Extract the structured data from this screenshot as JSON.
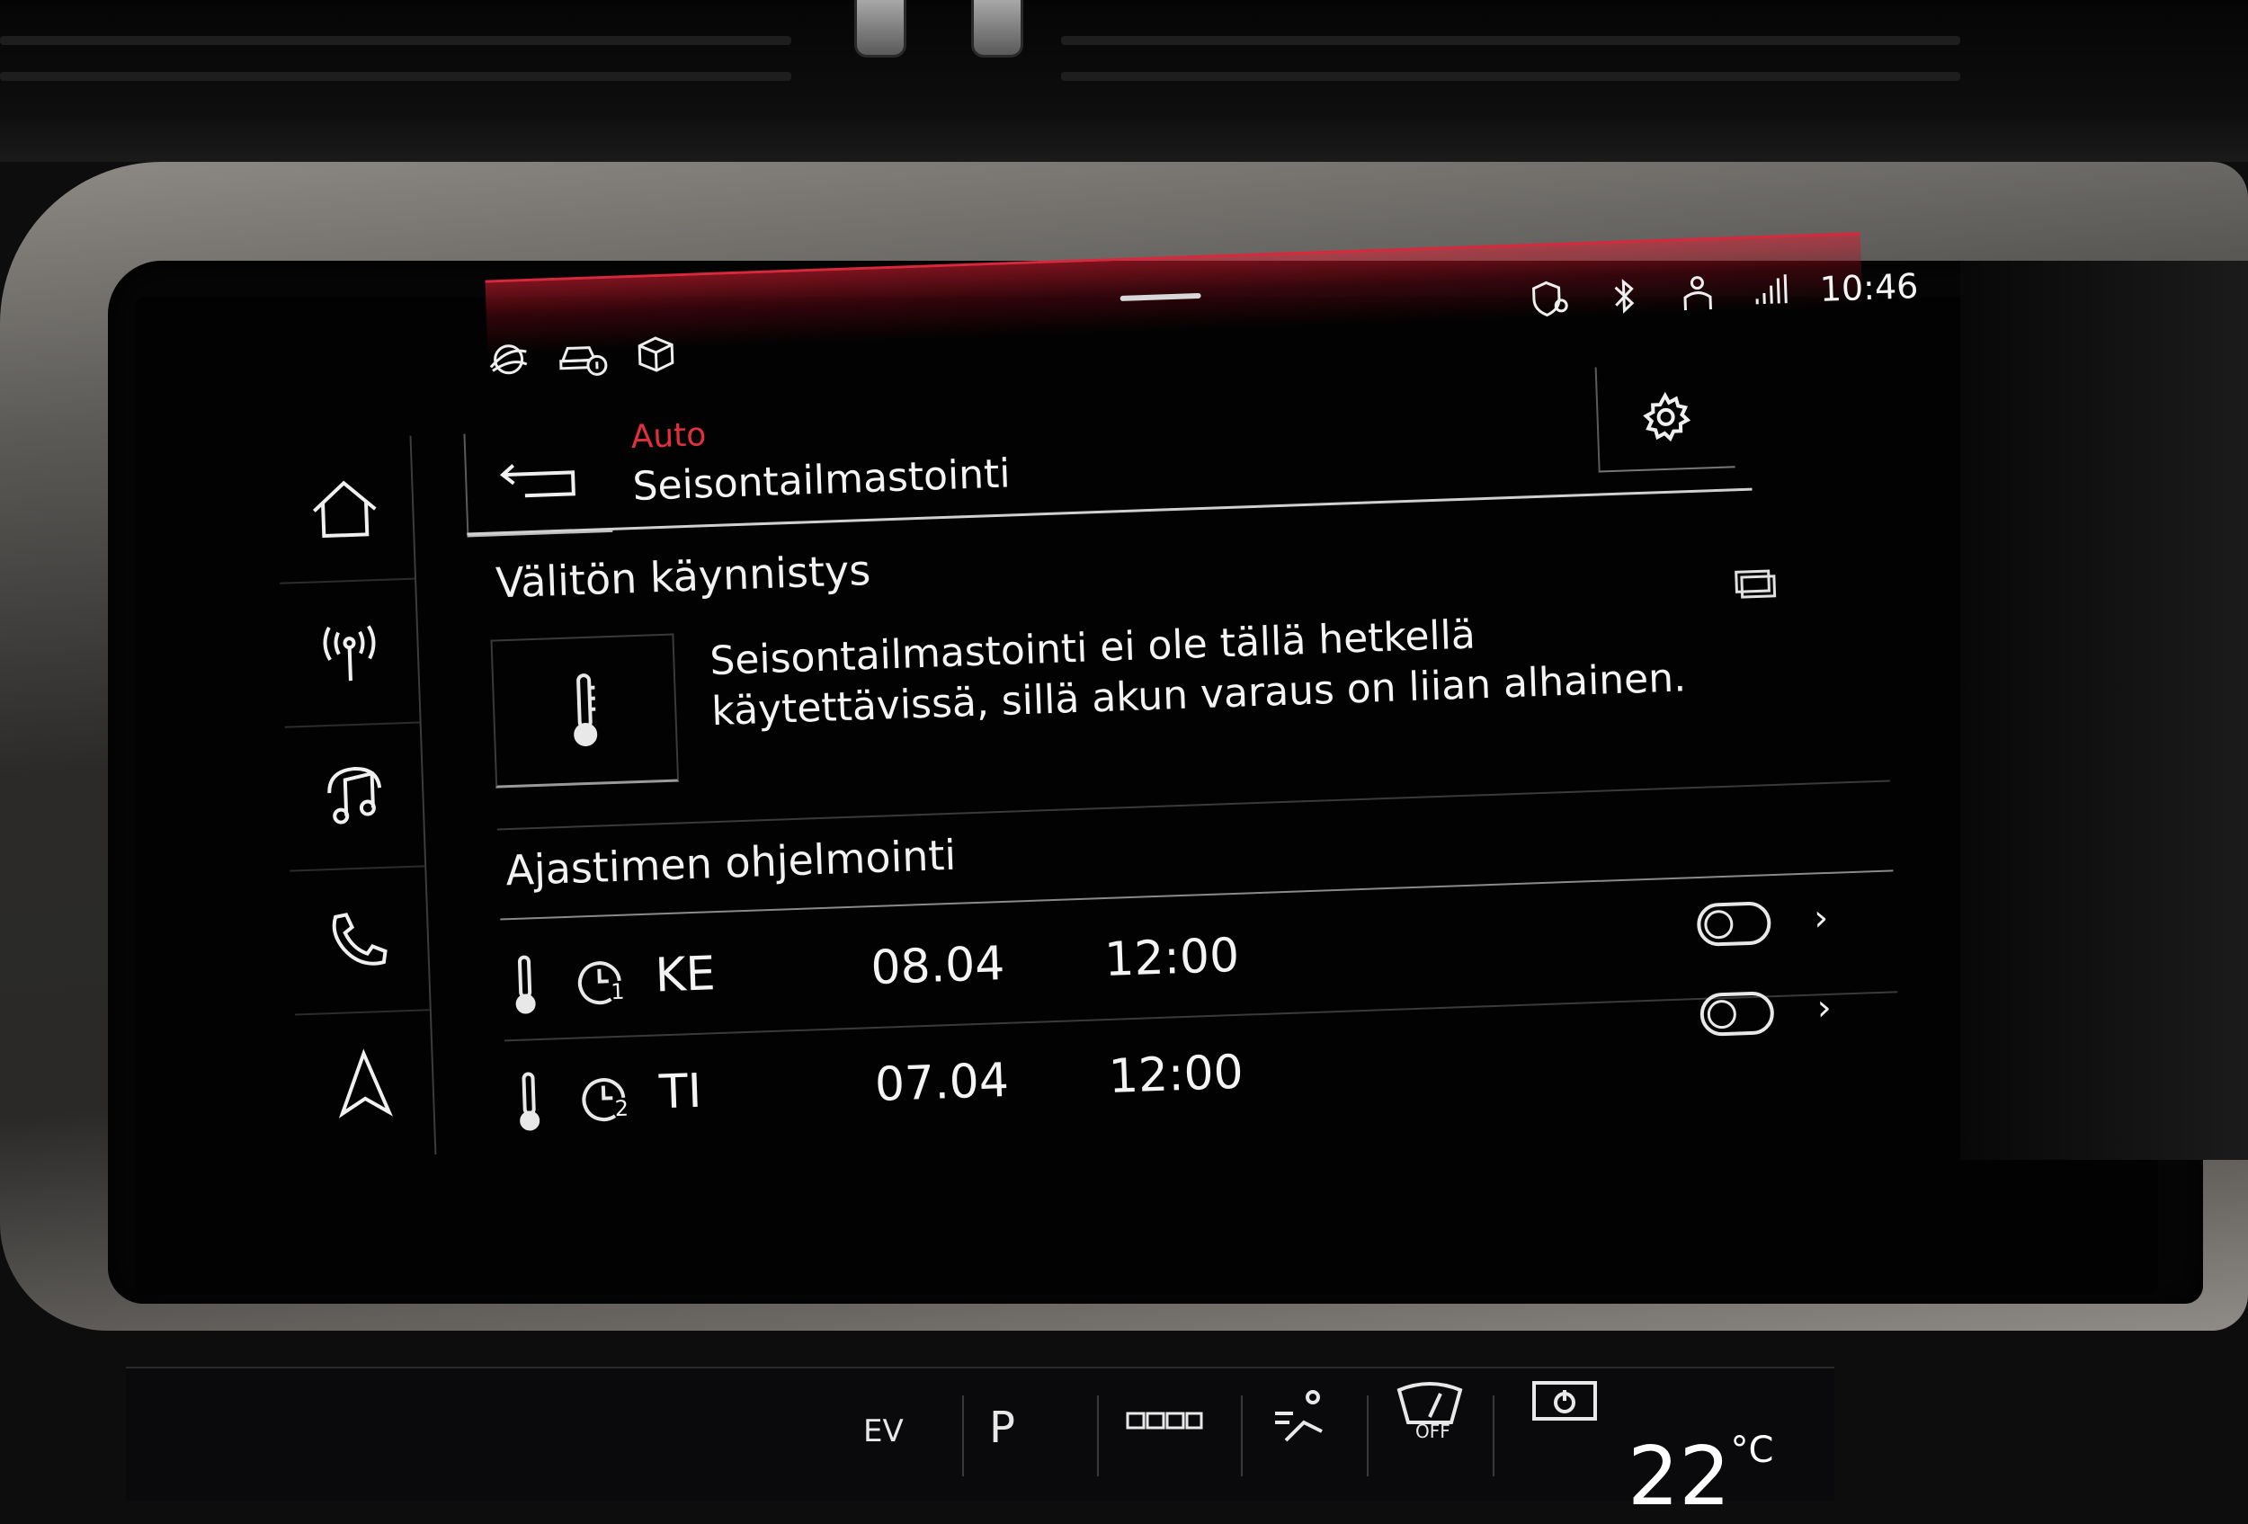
{
  "status_bar": {
    "time": "10:46",
    "left_icons": [
      "connect-services-icon",
      "car-info-icon",
      "package-icon"
    ],
    "right_icons": [
      "location-shield-icon",
      "bluetooth-icon",
      "user-profile-icon",
      "lte-signal-icon"
    ]
  },
  "sidebar": {
    "items": [
      {
        "name": "home",
        "icon": "home-icon"
      },
      {
        "name": "radio",
        "icon": "radio-antenna-icon"
      },
      {
        "name": "media",
        "icon": "music-note-icon"
      },
      {
        "name": "phone",
        "icon": "phone-icon"
      },
      {
        "name": "navigation",
        "icon": "navigation-arrow-icon"
      }
    ]
  },
  "header": {
    "breadcrumb": "Auto",
    "title": "Seisontailmastointi"
  },
  "immediate_start": {
    "title": "Välitön käynnistys",
    "message_line1": "Seisontailmastointi ei ole tällä hetkellä",
    "message_line2": "käytettävissä, sillä akun varaus on liian alhainen."
  },
  "timer_programming": {
    "title": "Ajastimen ohjelmointi",
    "timers": [
      {
        "timer_number": "1",
        "day": "KE",
        "date": "08.04",
        "time": "12:00",
        "enabled": false
      },
      {
        "timer_number": "2",
        "day": "TI",
        "date": "07.04",
        "time": "12:00",
        "enabled": false
      }
    ]
  },
  "climate_bar": {
    "labels": [
      "EV",
      "P",
      "OFF"
    ],
    "temperature": "22",
    "temperature_unit": "°C"
  },
  "colors": {
    "accent_red": "#e0303c",
    "text": "#f2f2f2",
    "background": "#020202"
  }
}
